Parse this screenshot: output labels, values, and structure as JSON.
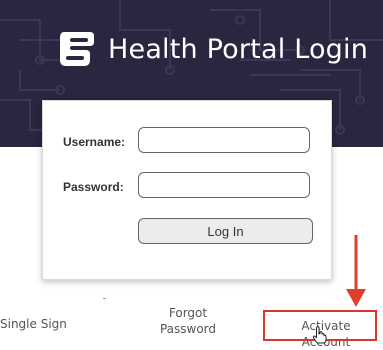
{
  "header": {
    "title": "Health Portal Login",
    "logo_icon": "portal-logo-icon",
    "background_color": "#2b2540"
  },
  "form": {
    "username_label": "Username:",
    "username_value": "",
    "password_label": "Password:",
    "password_value": "",
    "login_button_label": "Log In"
  },
  "footer": {
    "single_sign_label": "Single Sign",
    "forgot_password_label": "Forgot\nPassword",
    "activate_account_label": "Activate Account"
  },
  "annotation": {
    "highlight_color": "#d9362b",
    "arrow_icon": "down-arrow-icon",
    "cursor_icon": "hand-pointer-icon"
  }
}
